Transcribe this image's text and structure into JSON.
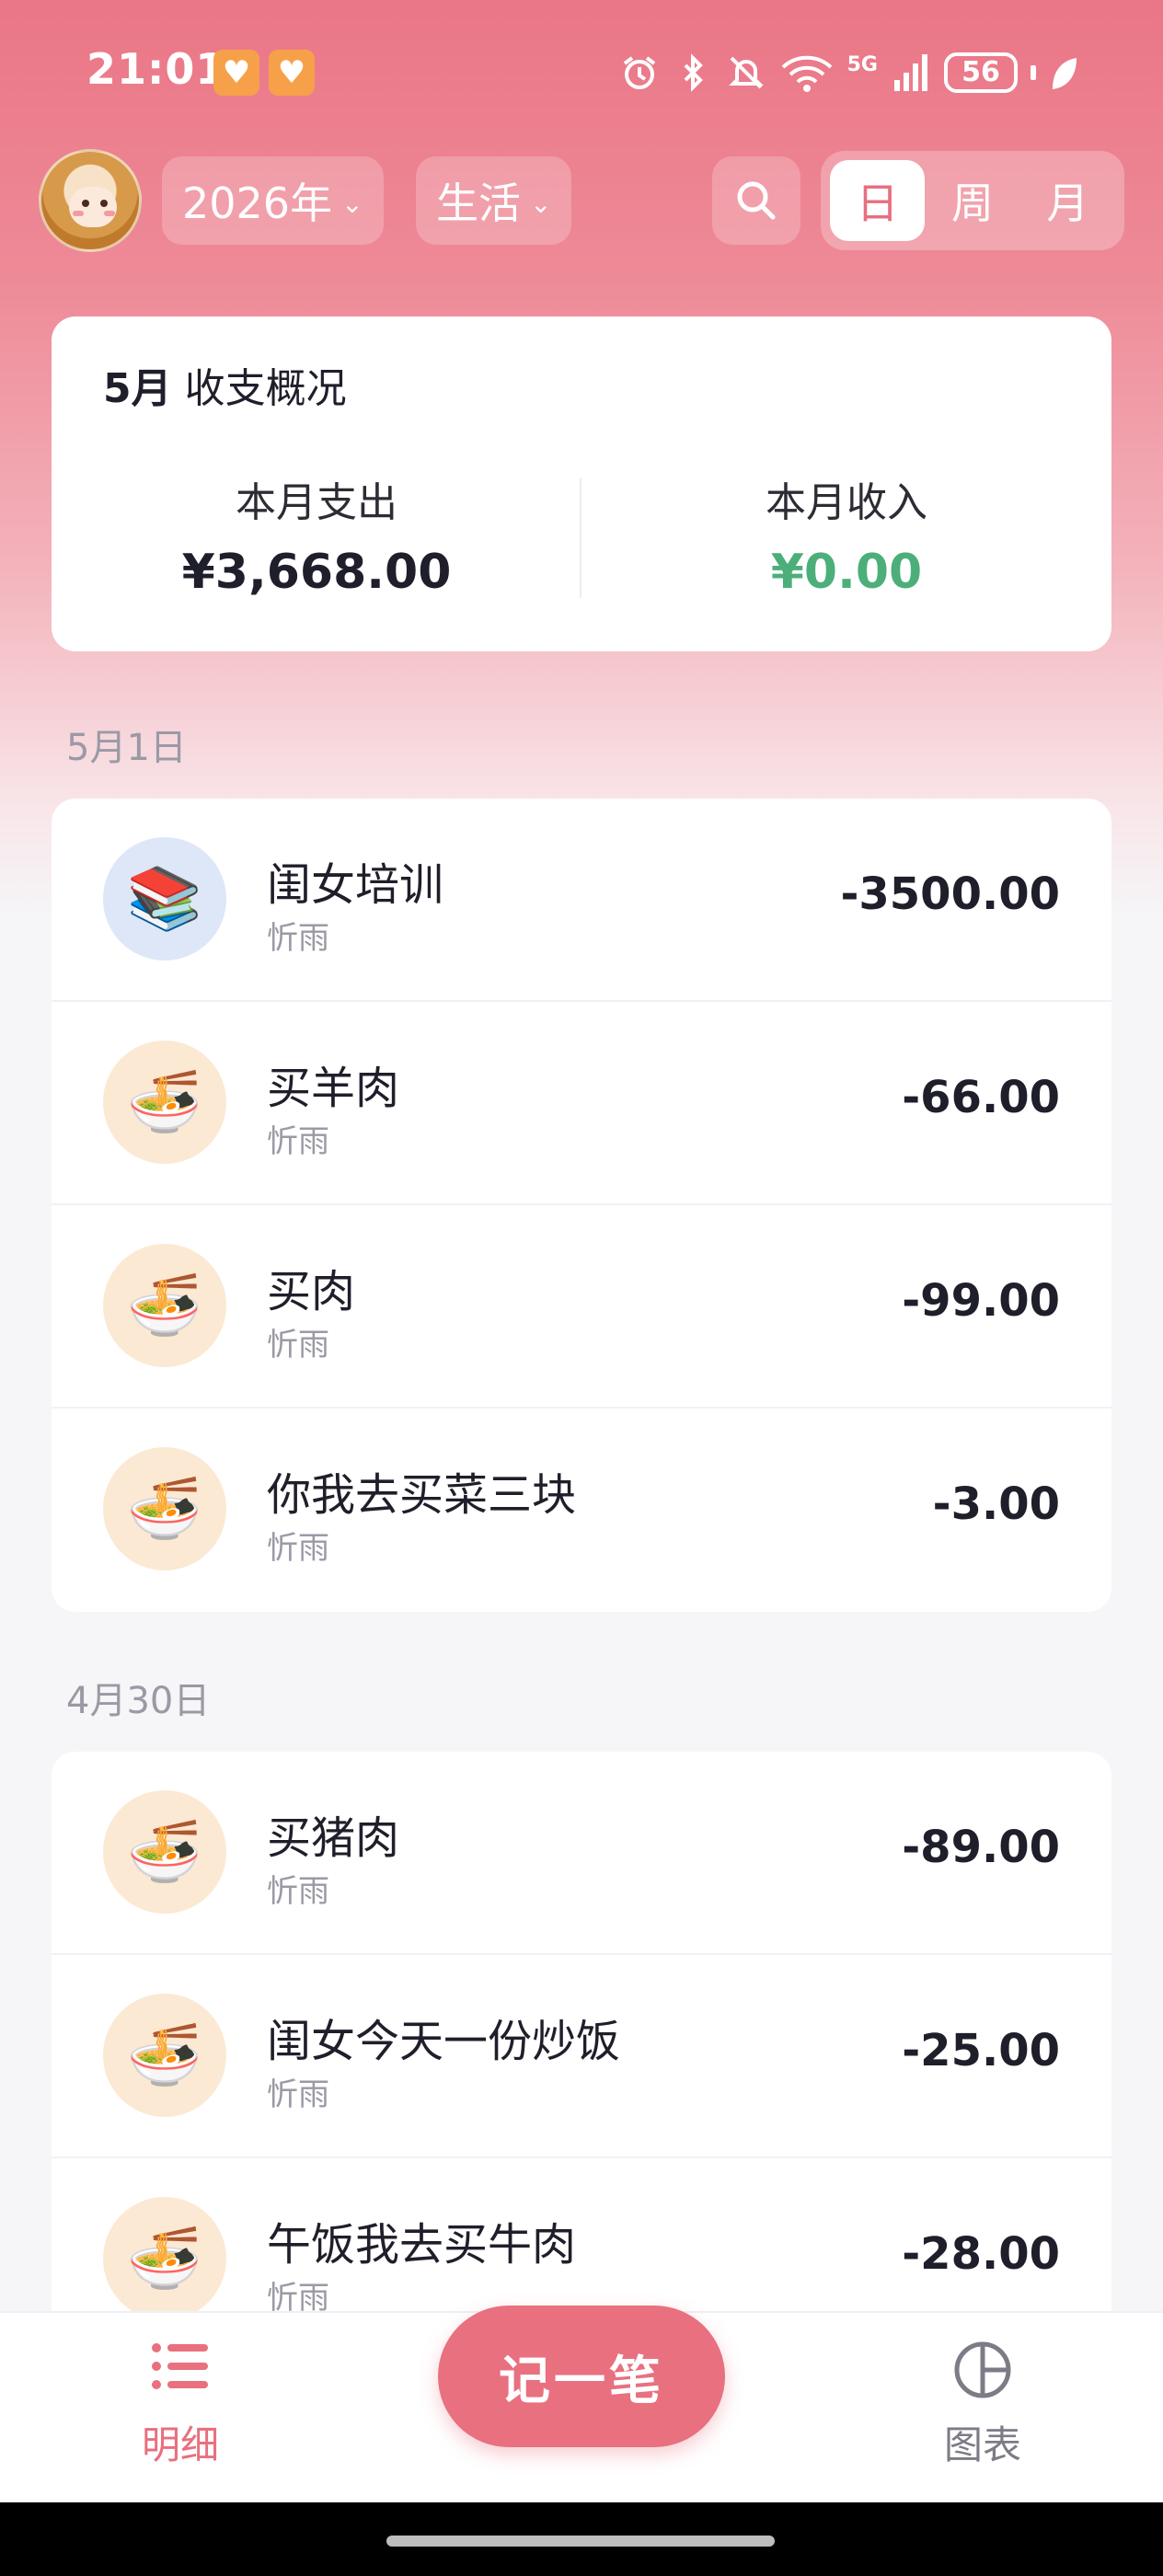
{
  "status_bar": {
    "time": "21:01",
    "battery": "56",
    "network": "5G",
    "icons": [
      "alarm-icon",
      "bluetooth-icon",
      "mute-icon",
      "wifi-icon",
      "signal-icon",
      "battery-icon",
      "leaf-icon"
    ]
  },
  "header": {
    "year_label": "2026年",
    "book_label": "生活",
    "view_tabs": [
      "日",
      "周",
      "月"
    ],
    "active_tab": "日"
  },
  "summary": {
    "month": "5月",
    "title": "收支概况",
    "expense_label": "本月支出",
    "expense_value": "¥3,668.00",
    "income_label": "本月收入",
    "income_value": "¥0.00"
  },
  "days": [
    {
      "date": "5月1日",
      "items": [
        {
          "title": "闺女培训",
          "user": "忻雨",
          "amount": "-3500.00",
          "icon": "books-icon"
        },
        {
          "title": "买羊肉",
          "user": "忻雨",
          "amount": "-66.00",
          "icon": "noodles-icon"
        },
        {
          "title": "买肉",
          "user": "忻雨",
          "amount": "-99.00",
          "icon": "noodles-icon"
        },
        {
          "title": "你我去买菜三块",
          "user": "忻雨",
          "amount": "-3.00",
          "icon": "noodles-icon"
        }
      ]
    },
    {
      "date": "4月30日",
      "items": [
        {
          "title": "买猪肉",
          "user": "忻雨",
          "amount": "-89.00",
          "icon": "noodles-icon"
        },
        {
          "title": "闺女今天一份炒饭",
          "user": "忻雨",
          "amount": "-25.00",
          "icon": "noodles-icon"
        },
        {
          "title": "午饭我去买牛肉",
          "user": "忻雨",
          "amount": "-28.00",
          "icon": "noodles-icon"
        }
      ]
    }
  ],
  "bottom_nav": {
    "detail_label": "明细",
    "add_label": "记一笔",
    "chart_label": "图表"
  },
  "colors": {
    "accent": "#e8707f",
    "income": "#4caf7a",
    "text": "#1f1f2b",
    "muted": "#9a9aa5"
  }
}
